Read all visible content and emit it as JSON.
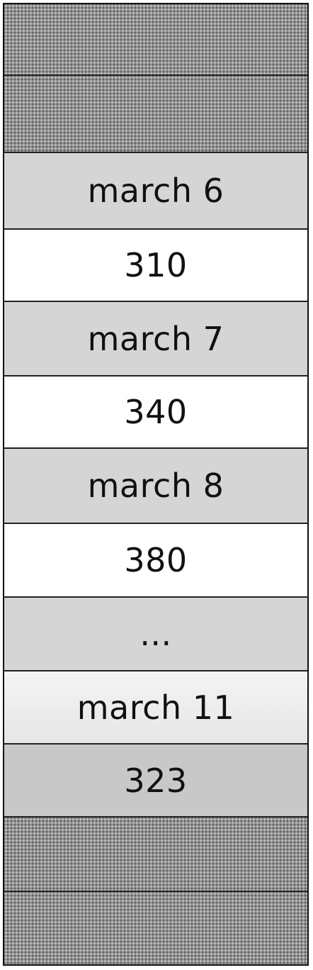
{
  "memory_stack": {
    "cells": [
      {
        "kind": "hatched",
        "text": ""
      },
      {
        "kind": "hatched",
        "text": ""
      },
      {
        "kind": "grey",
        "text": "march 6"
      },
      {
        "kind": "white",
        "text": "310"
      },
      {
        "kind": "grey",
        "text": "march 7"
      },
      {
        "kind": "white",
        "text": "340"
      },
      {
        "kind": "grey",
        "text": "march 8"
      },
      {
        "kind": "white",
        "text": "380"
      },
      {
        "kind": "grey",
        "text": "..."
      },
      {
        "kind": "light",
        "text": "march 11"
      },
      {
        "kind": "midgrey",
        "text": "323"
      },
      {
        "kind": "hatched",
        "text": ""
      },
      {
        "kind": "hatched",
        "text": ""
      }
    ]
  }
}
